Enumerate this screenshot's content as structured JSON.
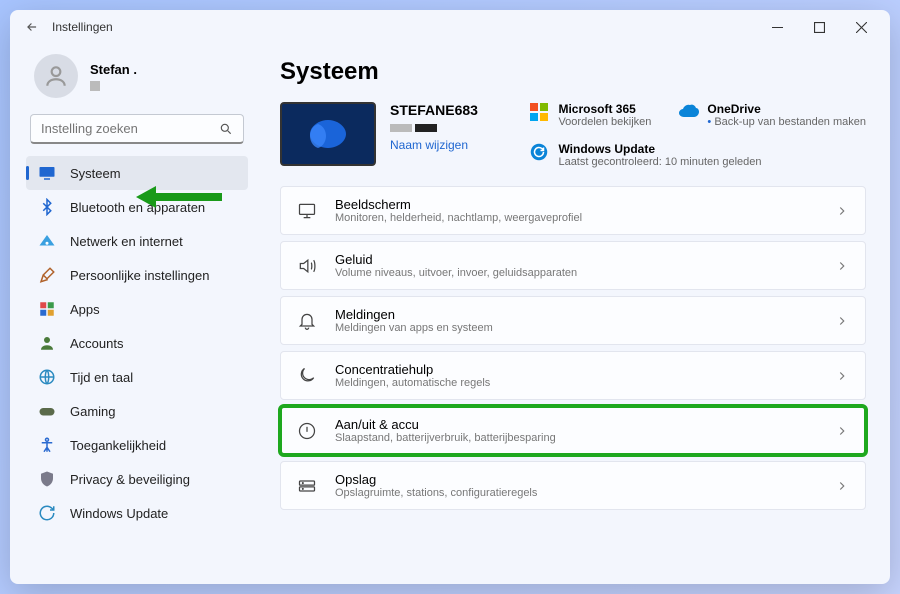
{
  "window": {
    "title": "Instellingen"
  },
  "profile": {
    "name": "Stefan ."
  },
  "search": {
    "placeholder": "Instelling zoeken"
  },
  "sidebar": {
    "items": [
      {
        "label": "Systeem",
        "icon": "monitor",
        "selected": true
      },
      {
        "label": "Bluetooth en apparaten",
        "icon": "bluetooth",
        "selected": false
      },
      {
        "label": "Netwerk en internet",
        "icon": "wifi",
        "selected": false
      },
      {
        "label": "Persoonlijke instellingen",
        "icon": "brush",
        "selected": false
      },
      {
        "label": "Apps",
        "icon": "apps",
        "selected": false
      },
      {
        "label": "Accounts",
        "icon": "person",
        "selected": false
      },
      {
        "label": "Tijd en taal",
        "icon": "globe",
        "selected": false
      },
      {
        "label": "Gaming",
        "icon": "gamepad",
        "selected": false
      },
      {
        "label": "Toegankelijkheid",
        "icon": "access",
        "selected": false
      },
      {
        "label": "Privacy & beveiliging",
        "icon": "shield",
        "selected": false
      },
      {
        "label": "Windows Update",
        "icon": "update",
        "selected": false
      }
    ]
  },
  "page": {
    "heading": "Systeem",
    "device": {
      "name": "STEFANE683",
      "rename": "Naam wijzigen"
    },
    "links": [
      {
        "title": "Microsoft 365",
        "sub": "Voordelen bekijken",
        "icon": "ms365",
        "bullet": false
      },
      {
        "title": "OneDrive",
        "sub": "Back-up van bestanden maken",
        "icon": "onedrive",
        "bullet": true
      },
      {
        "title": "Windows Update",
        "sub": "Laatst gecontroleerd: 10 minuten geleden",
        "icon": "update",
        "bullet": false
      }
    ],
    "cards": [
      {
        "title": "Beeldscherm",
        "sub": "Monitoren, helderheid, nachtlamp, weergaveprofiel",
        "icon": "display",
        "highlight": false
      },
      {
        "title": "Geluid",
        "sub": "Volume niveaus, uitvoer, invoer, geluidsapparaten",
        "icon": "sound",
        "highlight": false
      },
      {
        "title": "Meldingen",
        "sub": "Meldingen van apps en systeem",
        "icon": "bell",
        "highlight": false
      },
      {
        "title": "Concentratiehulp",
        "sub": "Meldingen, automatische regels",
        "icon": "moon",
        "highlight": false
      },
      {
        "title": "Aan/uit & accu",
        "sub": "Slaapstand, batterijverbruik, batterijbesparing",
        "icon": "power",
        "highlight": true
      },
      {
        "title": "Opslag",
        "sub": "Opslagruimte, stations, configuratieregels",
        "icon": "storage",
        "highlight": false
      }
    ]
  }
}
